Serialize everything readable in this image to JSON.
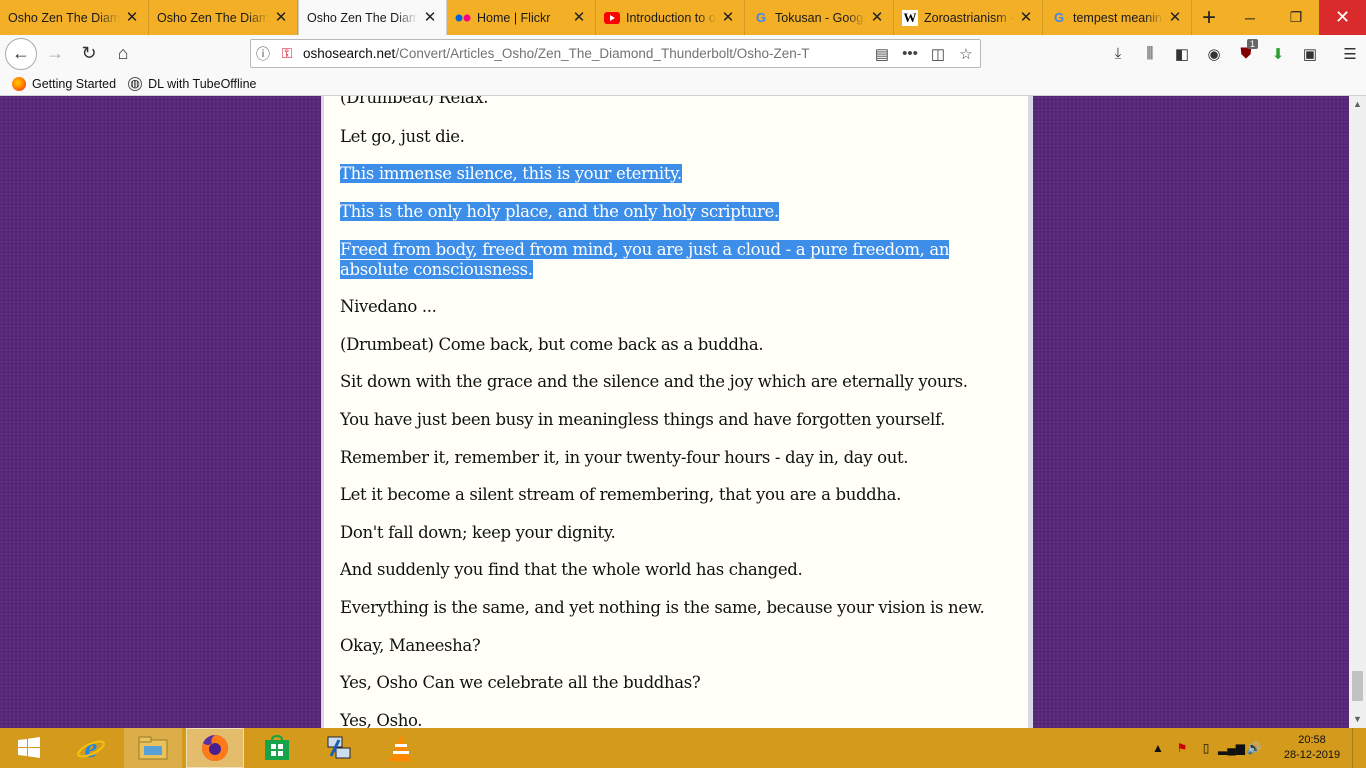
{
  "tabs": [
    {
      "title": "Osho Zen The Diamond",
      "favicon": "",
      "active": false
    },
    {
      "title": "Osho Zen The Diamond",
      "favicon": "",
      "active": false
    },
    {
      "title": "Osho Zen The Diamond",
      "favicon": "",
      "active": true
    },
    {
      "title": "Home | Flickr",
      "favicon": "flickr-icon",
      "active": false
    },
    {
      "title": "Introduction to o",
      "favicon": "youtube-icon",
      "active": false
    },
    {
      "title": "Tokusan - Google",
      "favicon": "google-icon",
      "active": false
    },
    {
      "title": "Zoroastrianism -",
      "favicon": "wikipedia-icon",
      "active": false
    },
    {
      "title": "tempest meaning",
      "favicon": "google-icon",
      "active": false
    }
  ],
  "address": {
    "domain": "oshosearch.net",
    "path": "/Convert/Articles_Osho/Zen_The_Diamond_Thunderbolt/Osho-Zen-T"
  },
  "toolbar": {
    "ublock_badge": "1"
  },
  "bookmarks": [
    {
      "label": "Getting Started",
      "icon": "firefox-icon"
    },
    {
      "label": "DL with TubeOffline",
      "icon": "globe-icon"
    }
  ],
  "article": {
    "paragraphs": [
      {
        "text": "(Drumbeat) Relax.",
        "selected": false
      },
      {
        "text": "Let go, just die.",
        "selected": false
      },
      {
        "text": "This immense silence, this is your eternity.",
        "selected": true
      },
      {
        "text": "This is the only holy place, and the only holy scripture.",
        "selected": true
      },
      {
        "text": "Freed from body, freed from mind, you are just a cloud - a pure freedom, an absolute consciousness.",
        "selected": true
      },
      {
        "text": "Nivedano ...",
        "selected": false
      },
      {
        "text": "(Drumbeat) Come back, but come back as a buddha.",
        "selected": false
      },
      {
        "text": "Sit down with the grace and the silence and the joy which are eternally yours.",
        "selected": false
      },
      {
        "text": "You have just been busy in meaningless things and have forgotten yourself.",
        "selected": false
      },
      {
        "text": "Remember it, remember it, in your twenty-four hours - day in, day out.",
        "selected": false
      },
      {
        "text": "Let it become a silent stream of remembering, that you are a buddha.",
        "selected": false
      },
      {
        "text": "Don't fall down; keep your dignity.",
        "selected": false
      },
      {
        "text": "And suddenly you find that the whole world has changed.",
        "selected": false
      },
      {
        "text": "Everything is the same, and yet nothing is the same, because your vision is new.",
        "selected": false
      },
      {
        "text": "Okay, Maneesha?",
        "selected": false
      },
      {
        "text": "Yes, Osho Can we celebrate all the buddhas?",
        "selected": false
      },
      {
        "text": "Yes, Osho.",
        "selected": false
      }
    ]
  },
  "taskbar": {
    "apps": [
      "start-icon",
      "ie-icon",
      "file-explorer-icon",
      "firefox-icon",
      "store-icon",
      "network-tool-icon",
      "vlc-icon"
    ],
    "time": "20:58",
    "date": "28-12-2019"
  },
  "colors": {
    "tabstrip": "#f3b027",
    "taskbar": "#d49a1c",
    "selection": "#3d8ee8",
    "page_bg": "#58287a"
  }
}
